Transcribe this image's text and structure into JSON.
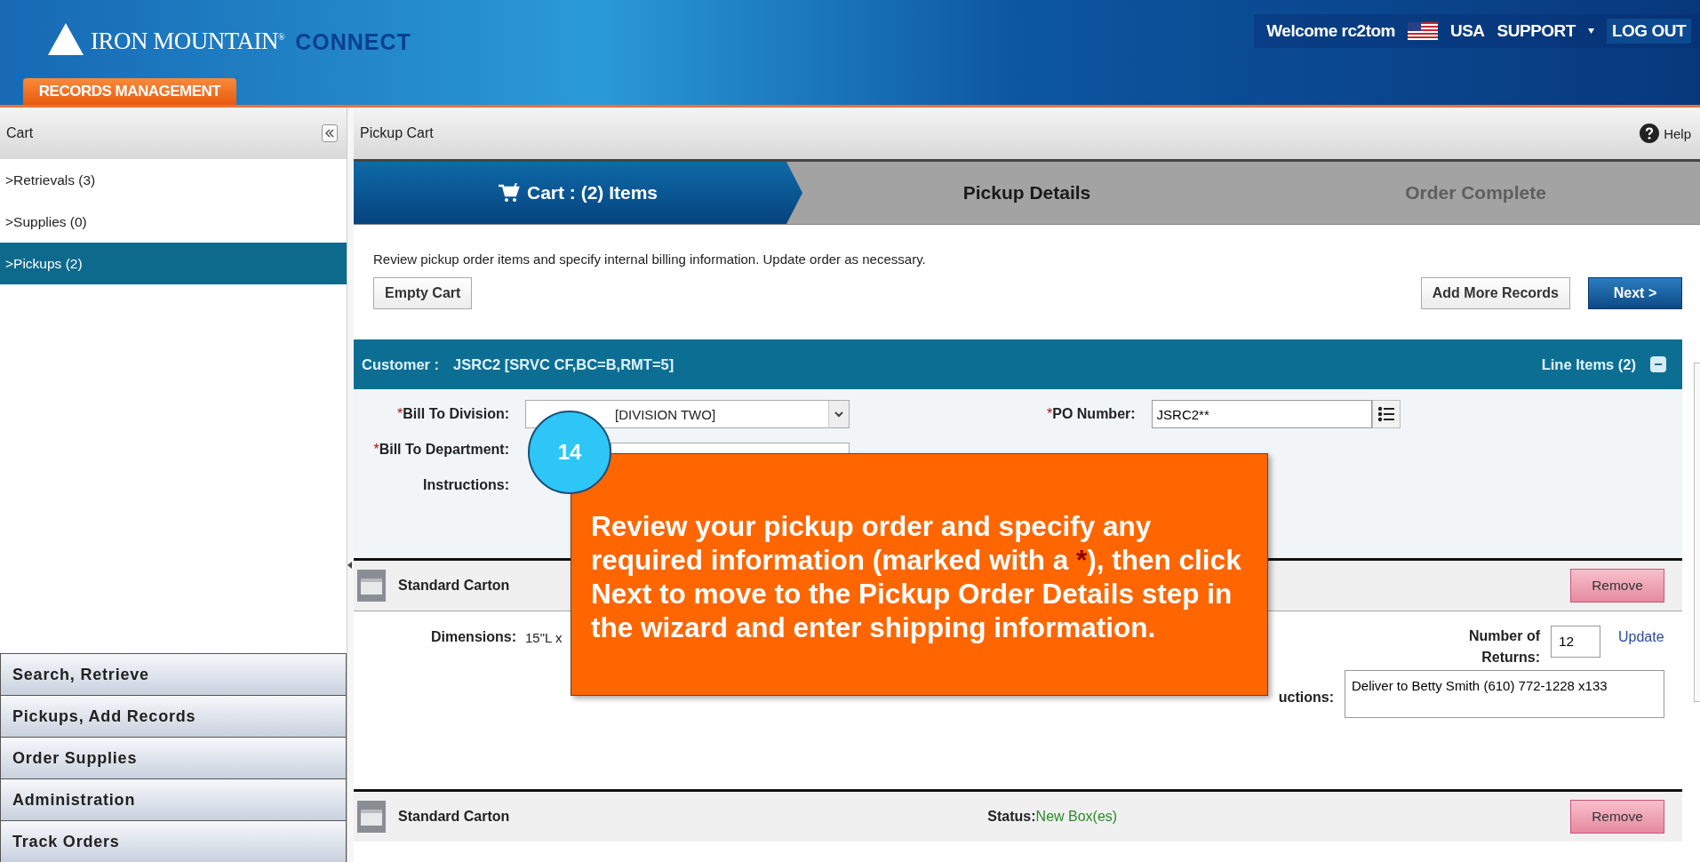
{
  "header": {
    "brand": "IRON MOUNTAIN",
    "brand_mark": "®",
    "product": "CONNECT",
    "welcome": "Welcome rc2tom",
    "country": "USA",
    "support": "SUPPORT",
    "log_out": "LOG OUT"
  },
  "app_tabs": [
    {
      "label": "RECORDS MANAGEMENT",
      "selected": true
    }
  ],
  "sidebar": {
    "title": "Cart",
    "items": [
      {
        "label": ">Retrievals (3)",
        "selected": false
      },
      {
        "label": ">Supplies (0)",
        "selected": false
      },
      {
        "label": ">Pickups (2)",
        "selected": true
      }
    ],
    "nav": [
      "Search, Retrieve",
      "Pickups, Add Records",
      "Order Supplies",
      "Administration",
      "Track Orders"
    ]
  },
  "main": {
    "title": "Pickup Cart",
    "help": "Help",
    "steps": [
      {
        "label": "Cart : (2) Items",
        "selected": true,
        "disabled": false
      },
      {
        "label": "Pickup Details",
        "selected": false,
        "disabled": false
      },
      {
        "label": "Order Complete",
        "selected": false,
        "disabled": true
      }
    ],
    "intro": "Review pickup order items and specify internal billing information. Update order as necessary.",
    "buttons": {
      "empty_cart": "Empty Cart",
      "add_more": "Add More Records",
      "next": "Next >"
    },
    "customer": {
      "label": "Customer :",
      "value": "JSRC2 [SRVC CF,BC=B,RMT=5]",
      "line_items": "Line Items (2)",
      "expanded": true
    },
    "billing": [
      {
        "kind": "select",
        "mark": "*",
        "label": "Bill To Division:",
        "value": "[DIVISION TWO]"
      },
      {
        "kind": "select",
        "mark": "*",
        "label": "Bill To Department:"
      },
      {
        "kind": "text",
        "label": "Instructions:"
      }
    ],
    "po": {
      "mark": "*",
      "label": "PO Number:",
      "value": "JSRC2**"
    },
    "items": [
      {
        "name": "Standard Carton",
        "remove": "Remove",
        "dimensions_label": "Dimensions:",
        "dimensions": "15\"L x",
        "returns_label": "Number of Returns:",
        "returns": "12",
        "update": "Update",
        "instructions_label": "uctions:",
        "instructions": "Deliver to Betty Smith (610) 772-1228 x133"
      },
      {
        "name": "Standard Carton",
        "remove": "Remove",
        "status_label": "Status:",
        "status": "New Box(es)"
      }
    ]
  },
  "callout": {
    "number": "14",
    "text_before": "Review your pickup order and specify any required information (marked with a ",
    "mark": "*",
    "text_after": "), then click Next to move to the Pickup Order Details step in the wizard and enter shipping information."
  }
}
